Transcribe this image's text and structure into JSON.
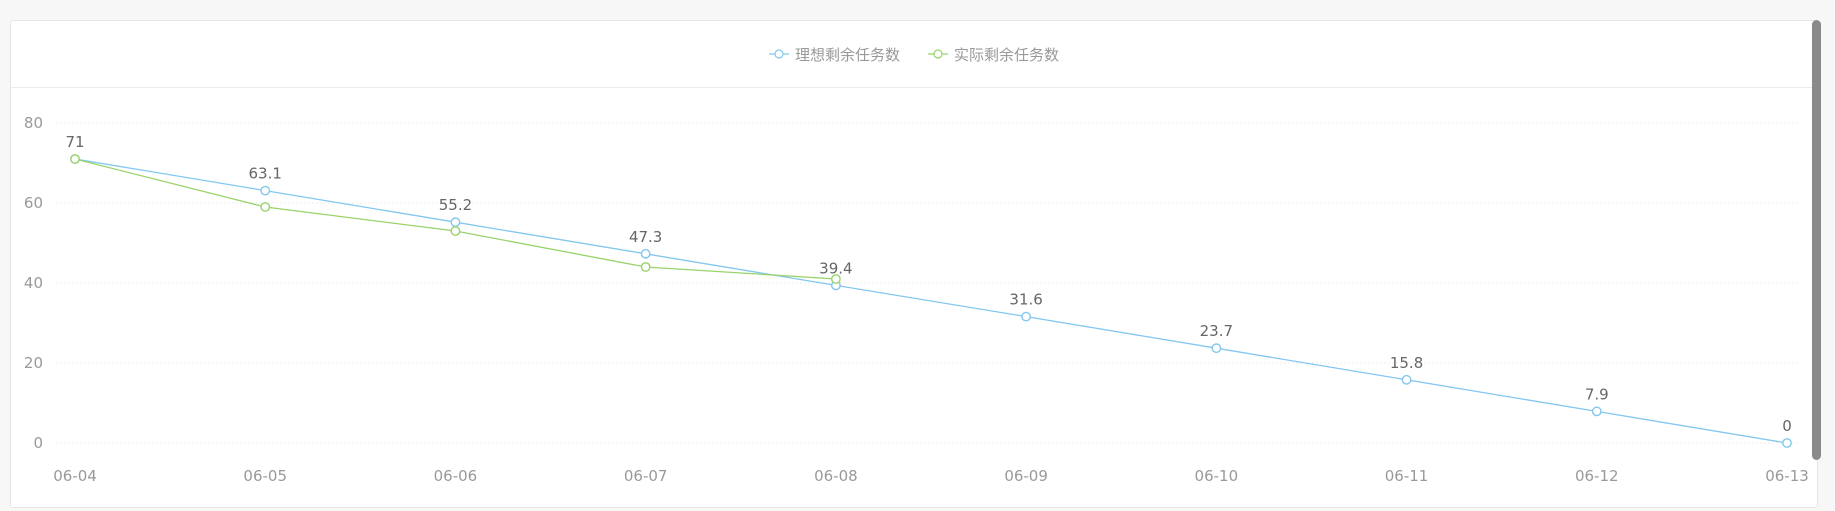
{
  "chart_data": {
    "type": "line",
    "categories": [
      "06-04",
      "06-05",
      "06-06",
      "06-07",
      "06-08",
      "06-09",
      "06-10",
      "06-11",
      "06-12",
      "06-13"
    ],
    "series": [
      {
        "name": "理想剩余任务数",
        "color": "#82c7ee",
        "values": [
          71,
          63.1,
          55.2,
          47.3,
          39.4,
          31.6,
          23.7,
          15.8,
          7.9,
          0
        ],
        "show_labels": true
      },
      {
        "name": "实际剩余任务数",
        "color": "#98d36b",
        "values": [
          71,
          59,
          53,
          44,
          41,
          null,
          null,
          null,
          null,
          null
        ],
        "show_labels": false
      }
    ],
    "yticks": [
      0,
      20,
      40,
      60,
      80
    ],
    "ylim": [
      0,
      80
    ],
    "grid": true,
    "legend_position": "top-center"
  }
}
